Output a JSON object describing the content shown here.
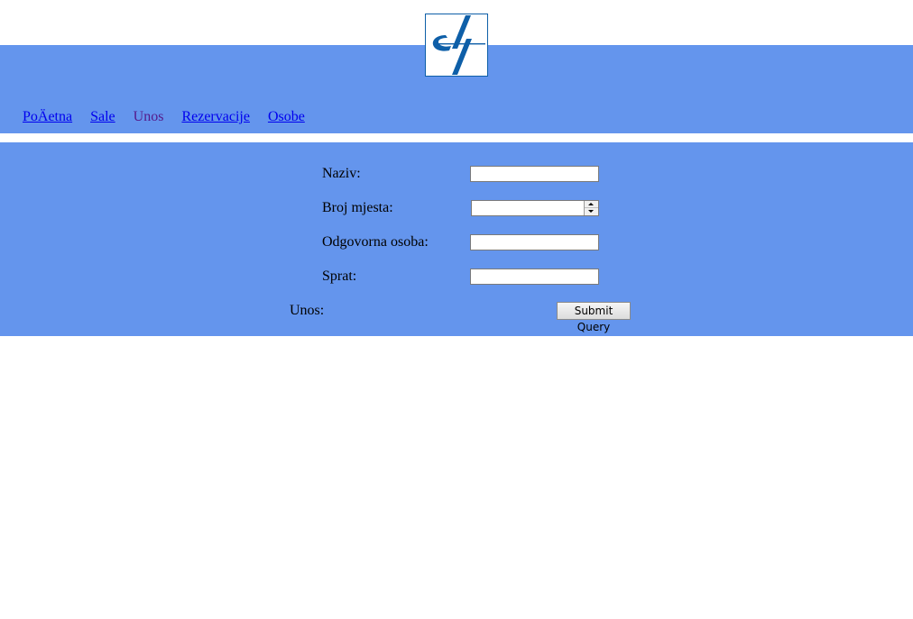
{
  "logo": {
    "icon": "institution-logo-icon",
    "color": "#0e5fa8"
  },
  "nav": {
    "items": [
      {
        "label": "PoÄetna",
        "state": "link"
      },
      {
        "label": "Sale",
        "state": "link"
      },
      {
        "label": "Unos",
        "state": "current"
      },
      {
        "label": "Rezervacije",
        "state": "link"
      },
      {
        "label": "Osobe",
        "state": "link"
      }
    ]
  },
  "form": {
    "fields": [
      {
        "label": "Naziv:",
        "value": ""
      },
      {
        "label": "Broj mjesta:",
        "value": ""
      },
      {
        "label": "Odgovorna osoba:",
        "value": ""
      },
      {
        "label": "Sprat:",
        "value": ""
      }
    ],
    "submit_label": "Unos:",
    "submit_button": "Submit Query"
  },
  "colors": {
    "band": "#6495ed",
    "link": "#0000ee",
    "visited_link": "#551a8b"
  }
}
